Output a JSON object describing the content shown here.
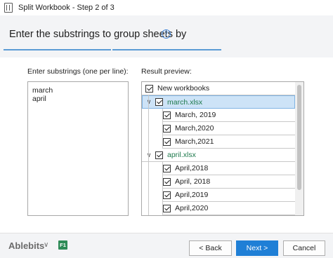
{
  "window": {
    "title": "Split Workbook - Step 2 of 3"
  },
  "header": {
    "title": "Enter the substrings to group sheets by",
    "help_icon": "help-icon"
  },
  "left": {
    "label": "Enter substrings (one per line):",
    "lines": [
      "march",
      "april"
    ]
  },
  "right": {
    "label": "Result preview:",
    "root": "New workbooks",
    "workbooks": [
      {
        "name": "march.xlsx",
        "sheets": [
          "March, 2019",
          "March,2020",
          "March,2021"
        ]
      },
      {
        "name": "april.xlsx",
        "sheets": [
          "April,2018",
          "April, 2018",
          "April,2019",
          "April,2020"
        ]
      }
    ]
  },
  "footer": {
    "brand": "Ablebits",
    "f1": "F1",
    "back": "< Back",
    "next": "Next >",
    "cancel": "Cancel"
  },
  "colors": {
    "accent": "#1f7fd6",
    "workbook_text": "#1f7a4d",
    "selection": "#cde3f7"
  }
}
